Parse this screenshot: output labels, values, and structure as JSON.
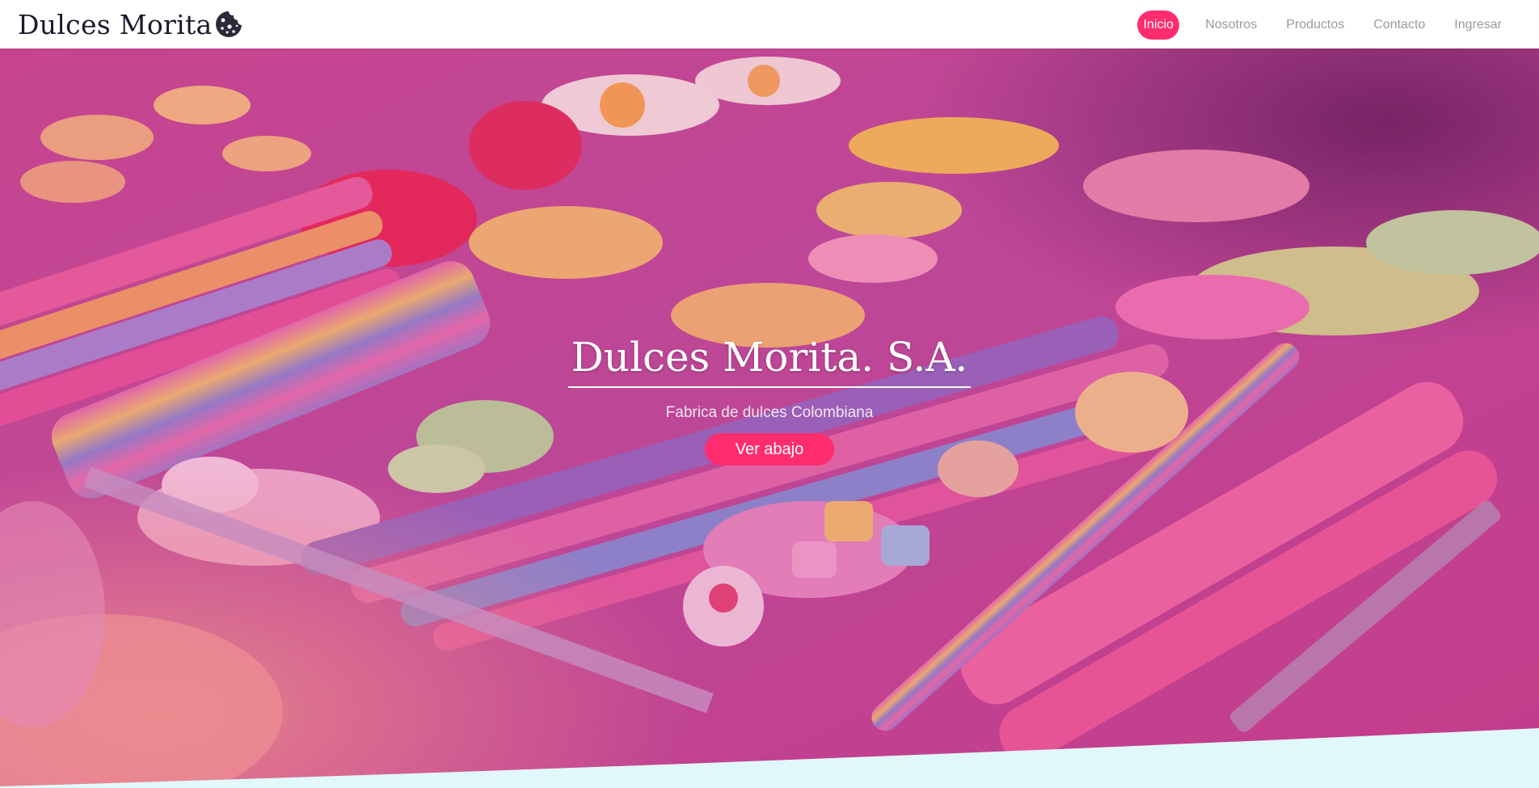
{
  "brand": {
    "name": "Dulces Morita",
    "logo_icon": "cookie-icon"
  },
  "nav": {
    "items": [
      {
        "label": "Inicio",
        "active": true
      },
      {
        "label": "Nosotros",
        "active": false
      },
      {
        "label": "Productos",
        "active": false
      },
      {
        "label": "Contacto",
        "active": false
      },
      {
        "label": "Ingresar",
        "active": false
      }
    ]
  },
  "hero": {
    "title": "Dulces Morita. S.A.",
    "subtitle": "Fabrica de dulces Colombiana",
    "button_label": "Ver abajo"
  },
  "colors": {
    "accent": "#ff2d6e",
    "wave": "#e0f8fb",
    "brand_text": "#1b1b2a",
    "nav_text": "#9a9a9a"
  }
}
